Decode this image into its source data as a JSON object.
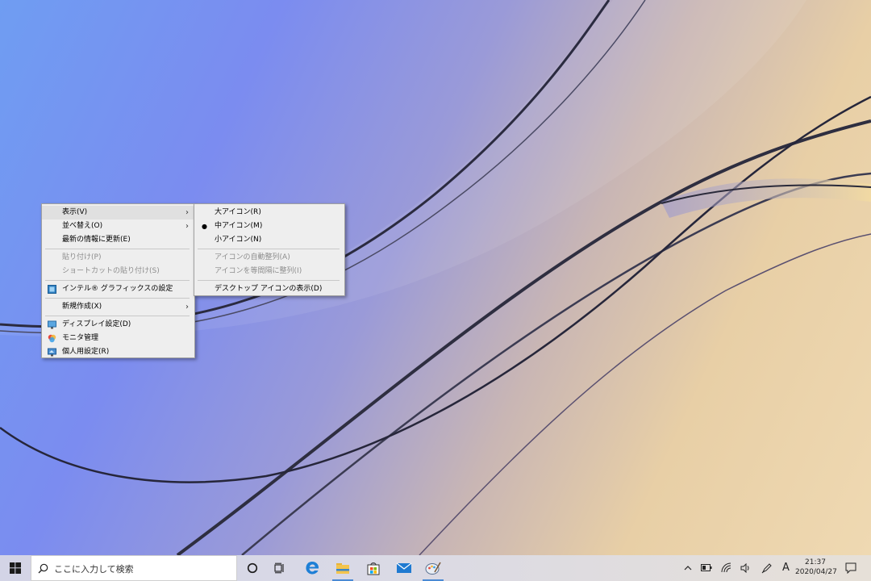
{
  "context_menu": {
    "items": [
      {
        "label": "表示(V)"
      },
      {
        "label": "並べ替え(O)"
      },
      {
        "label": "最新の情報に更新(E)"
      },
      {
        "label": "貼り付け(P)"
      },
      {
        "label": "ショートカットの貼り付け(S)"
      },
      {
        "label": "インテル® グラフィックスの設定"
      },
      {
        "label": "新規作成(X)"
      },
      {
        "label": "ディスプレイ設定(D)"
      },
      {
        "label": "モニタ管理"
      },
      {
        "label": "個人用設定(R)"
      }
    ]
  },
  "view_submenu": {
    "items": [
      {
        "label": "大アイコン(R)"
      },
      {
        "label": "中アイコン(M)"
      },
      {
        "label": "小アイコン(N)"
      },
      {
        "label": "アイコンの自動整列(A)"
      },
      {
        "label": "アイコンを等間隔に整列(I)"
      },
      {
        "label": "デスクトップ アイコンの表示(D)"
      }
    ]
  },
  "taskbar": {
    "search_placeholder": "ここに入力して検索",
    "ime_indicator": "A",
    "clock_time": "21:37",
    "clock_date": "2020/04/27"
  },
  "colors": {
    "accent": "#4a8ad4",
    "menu_bg": "#eeeeee",
    "disabled_text": "#8d8d8d"
  }
}
